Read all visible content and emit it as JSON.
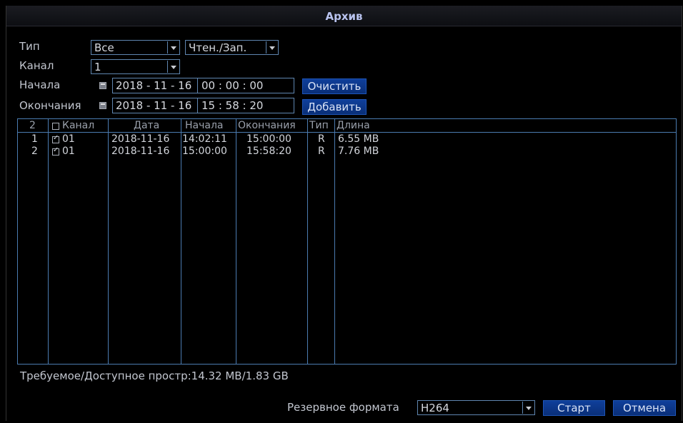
{
  "window": {
    "title": "Архив"
  },
  "filters": {
    "type_label": "Тип",
    "type_value": "Все",
    "mode_value": "Чтен./Зап.",
    "channel_label": "Канал",
    "channel_value": "1",
    "start_label": "Начала",
    "start_date": "2018 - 11 - 16",
    "start_time": "00 : 00 : 00",
    "end_label": "Окончания",
    "end_date": "2018 - 11 - 16",
    "end_time": "15 : 58 : 20",
    "clear_label": "Очистить",
    "add_label": "Добавить"
  },
  "table": {
    "headers": {
      "count": "2",
      "channel": "Канал",
      "date": "Дата",
      "start": "Начала",
      "end": "Окончания",
      "type": "Тип",
      "length": "Длина"
    },
    "rows": [
      {
        "num": "1",
        "channel": "01",
        "date": "2018-11-16",
        "start": "14:02:11",
        "end": "15:00:00",
        "type": "R",
        "length": "6.55 MB"
      },
      {
        "num": "2",
        "channel": "01",
        "date": "2018-11-16",
        "start": "15:00:00",
        "end": "15:58:20",
        "type": "R",
        "length": "7.76 MB"
      }
    ]
  },
  "space": {
    "text": "Требуемое/Доступное простр:14.32 MB/1.83 GB"
  },
  "footer": {
    "format_label": "Резервное формата",
    "format_value": "H264",
    "start_label": "Старт",
    "cancel_label": "Отмена"
  }
}
